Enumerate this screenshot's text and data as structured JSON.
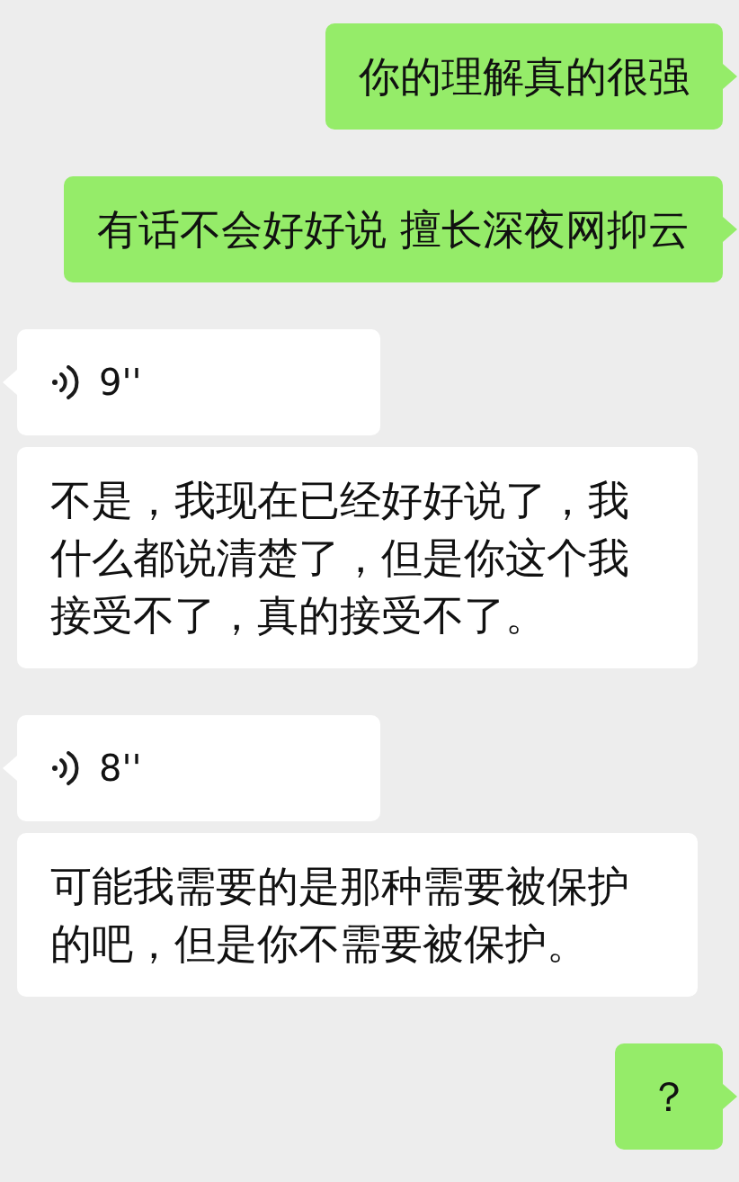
{
  "messages": [
    {
      "kind": "text",
      "outgoing": true,
      "tail": true,
      "text": "你的理解真的很强"
    },
    {
      "kind": "text",
      "outgoing": true,
      "tail": true,
      "text": "有话不会好好说 擅长深夜网抑云"
    },
    {
      "kind": "voice",
      "outgoing": false,
      "tail": true,
      "text": "9''"
    },
    {
      "kind": "text",
      "outgoing": false,
      "tail": false,
      "text": "不是，我现在已经好好说了，我什么都说清楚了，但是你这个我接受不了，真的接受不了。"
    },
    {
      "kind": "voice",
      "outgoing": false,
      "tail": true,
      "text": "8''"
    },
    {
      "kind": "text",
      "outgoing": false,
      "tail": false,
      "text": "可能我需要的是那种需要被保护的吧，但是你不需要被保护。"
    },
    {
      "kind": "text",
      "outgoing": true,
      "tail": true,
      "text": "？"
    }
  ]
}
